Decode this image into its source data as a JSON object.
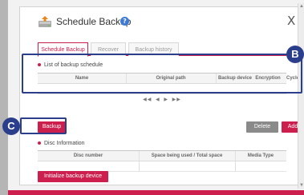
{
  "dialog": {
    "title": "Schedule Backup",
    "close_label": "X"
  },
  "tabs": [
    {
      "label": "Schedule Backup",
      "active": true
    },
    {
      "label": "Recover",
      "active": false
    },
    {
      "label": "Backup history",
      "active": false
    }
  ],
  "schedule_section": {
    "label": "List of backup schedule",
    "columns": [
      "Name",
      "Original path",
      "Backup device",
      "Encryption",
      "Cycle"
    ],
    "rows": [],
    "pager": {
      "first": "◀◀",
      "prev": "◀",
      "next": "▶",
      "last": "▶▶"
    }
  },
  "actions": {
    "backup_label": "Backup",
    "delete_label": "Delete",
    "add_label": "Add"
  },
  "disc_section": {
    "label": "Disc Information",
    "columns": [
      "Disc number",
      "Space being used / Total space",
      "Media Type"
    ],
    "rows": [
      [
        "",
        "",
        ""
      ]
    ]
  },
  "init_button_label": "Initialize backup device",
  "callouts": {
    "b": "B",
    "c": "C"
  },
  "colors": {
    "accent": "#cc1f4e",
    "callout": "#2a3e8c",
    "help_icon": "#3d7ad6"
  }
}
